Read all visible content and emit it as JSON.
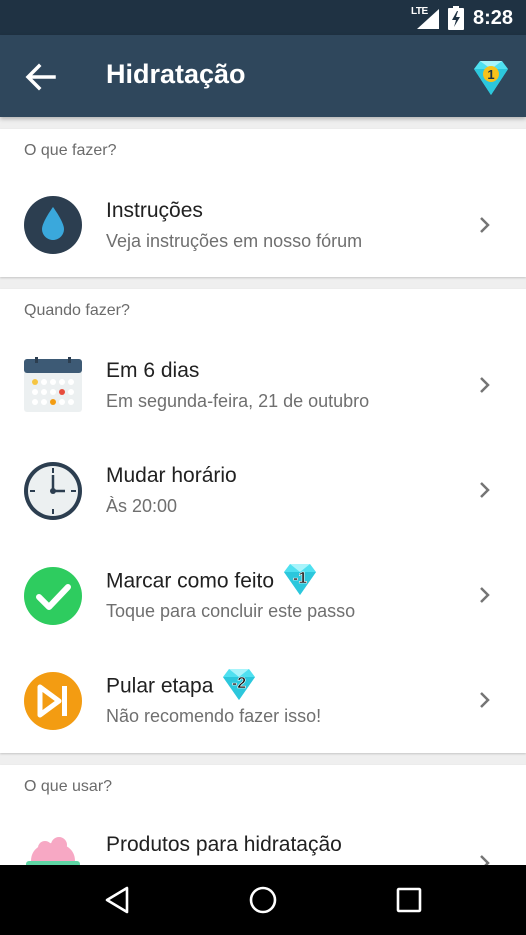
{
  "status_bar": {
    "network": "LTE",
    "time": "8:28"
  },
  "app_bar": {
    "title": "Hidratação",
    "gem_count": "1"
  },
  "sections": {
    "what": {
      "header": "O que fazer?",
      "instructions": {
        "title": "Instruções",
        "subtitle": "Veja instruções em nosso fórum"
      }
    },
    "when": {
      "header": "Quando fazer?",
      "schedule": {
        "title": "Em 6 dias",
        "subtitle": "Em segunda-feira, 21 de outubro"
      },
      "change_time": {
        "title": "Mudar horário",
        "subtitle": "Às 20:00"
      },
      "mark_done": {
        "title": "Marcar como feito",
        "subtitle": "Toque para concluir este passo",
        "gem_value": "-1"
      },
      "skip": {
        "title": "Pular etapa",
        "subtitle": "Não recomendo fazer isso!",
        "gem_value": "-2"
      }
    },
    "use": {
      "header": "O que usar?",
      "products": {
        "title": "Produtos para hidratação"
      }
    }
  },
  "colors": {
    "status_bar": "#1f3243",
    "app_bar": "#2f475c",
    "water_icon_bg": "#2c3e50",
    "water_drop": "#3aa8dc",
    "done_green": "#2ecc5f",
    "skip_orange": "#f39c12",
    "gem_cyan": "#4fe0f0"
  }
}
